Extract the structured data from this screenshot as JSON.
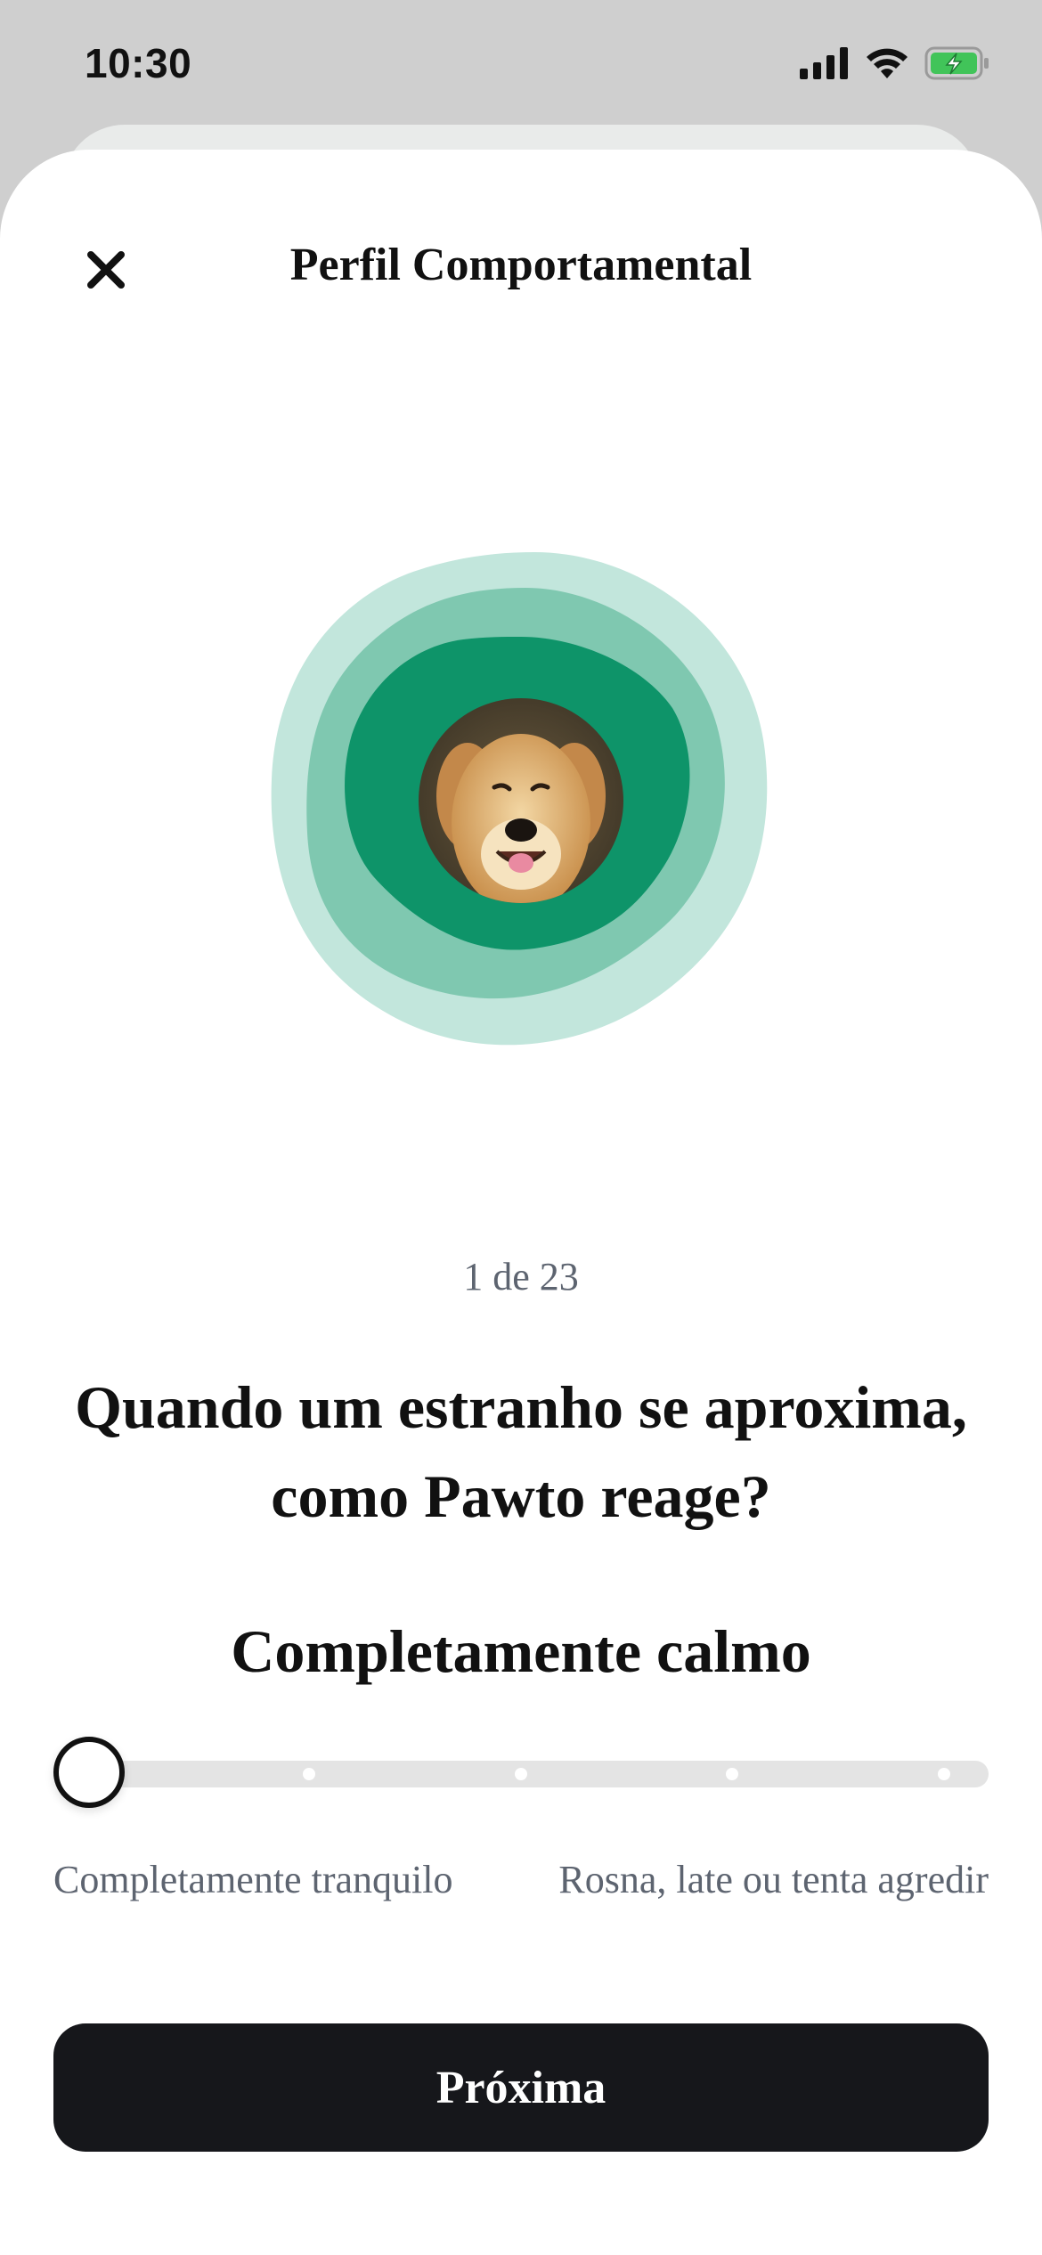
{
  "status_bar": {
    "time": "10:30",
    "icons": [
      "cellular-signal-icon",
      "wifi-icon",
      "battery-charging-icon"
    ]
  },
  "header": {
    "close_icon": "close-icon",
    "title": "Perfil Comportamental"
  },
  "hero": {
    "image": "dog-photo",
    "colors": {
      "outer": "#c2e6dc",
      "middle": "#7fc8b0",
      "inner": "#0e9469"
    }
  },
  "progress": {
    "text": "1 de 23",
    "current": 1,
    "total": 23
  },
  "question": {
    "text": "Quando um estranho se aproxima, como Pawto reage?"
  },
  "answer": {
    "selected_label": "Completamente calmo",
    "slider_position": 0,
    "slider_steps": 5
  },
  "scale": {
    "min_label": "Completamente tranquilo",
    "max_label": "Rosna, late ou tenta agredir"
  },
  "footer": {
    "next_label": "Próxima"
  },
  "colors": {
    "button_bg": "#16171b",
    "muted_text": "#5d6470",
    "accent": "#0e9469"
  }
}
